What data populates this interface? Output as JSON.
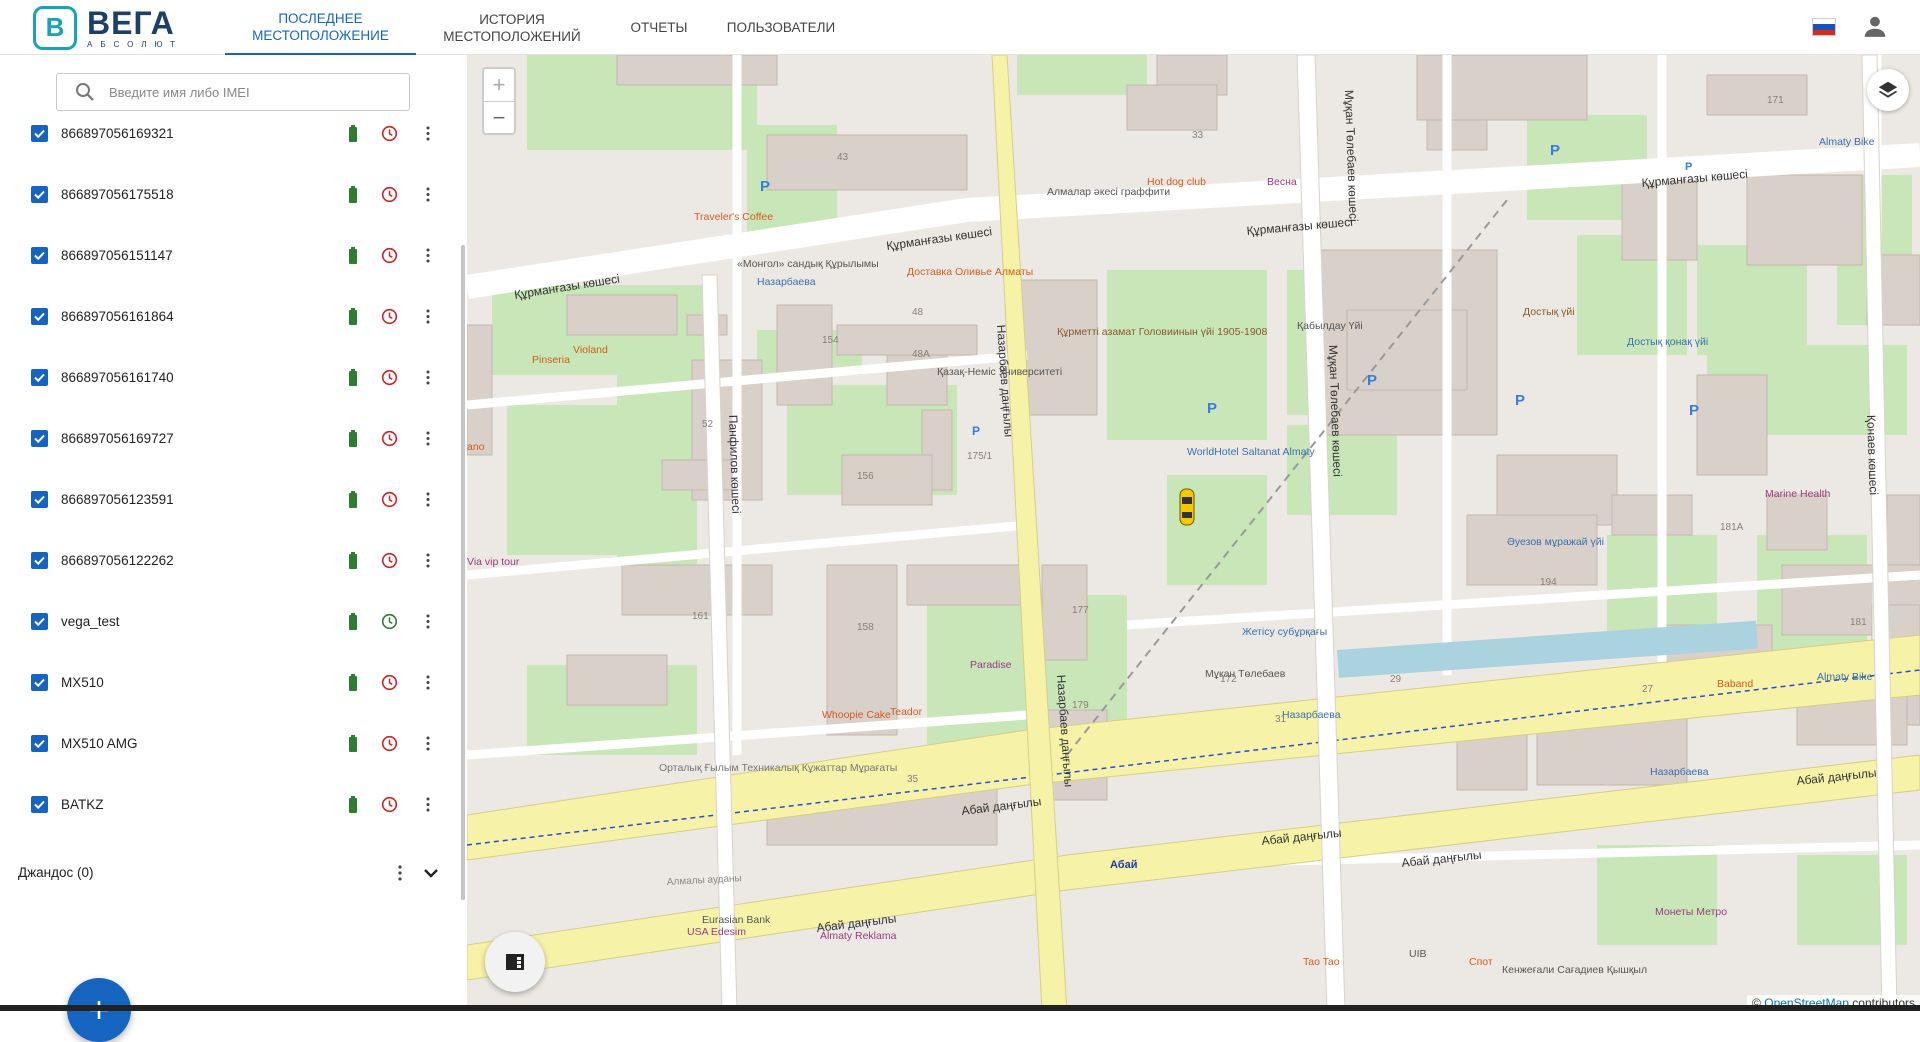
{
  "brand": {
    "name": "ВЕГА",
    "sub": "АБСОЛЮТ",
    "accent": "#1565c0",
    "logo_color": "#1aa3b6"
  },
  "nav": {
    "tabs": [
      {
        "line1": "ПОСЛЕДНЕЕ",
        "line2": "МЕСТОПОЛОЖЕНИЕ",
        "active": true
      },
      {
        "line1": "ИСТОРИЯ",
        "line2": "МЕСТОПОЛОЖЕНИЙ",
        "active": false
      },
      {
        "line1": "ОТЧЕТЫ",
        "line2": "",
        "active": false
      },
      {
        "line1": "ПОЛЬЗОВАТЕЛИ",
        "line2": "",
        "active": false
      }
    ],
    "language_flag": "ru-flag-icon",
    "user_icon": "account-icon"
  },
  "sidebar": {
    "search_placeholder": "Введите имя либо IMEI",
    "devices": [
      {
        "name": "866897056169321",
        "status": "inactive"
      },
      {
        "name": "866897056175518",
        "status": "inactive"
      },
      {
        "name": "866897056151147",
        "status": "inactive"
      },
      {
        "name": "866897056161864",
        "status": "inactive"
      },
      {
        "name": "866897056161740",
        "status": "inactive"
      },
      {
        "name": "866897056169727",
        "status": "inactive"
      },
      {
        "name": "866897056123591",
        "status": "inactive"
      },
      {
        "name": "866897056122262",
        "status": "inactive"
      },
      {
        "name": "vega_test",
        "status": "active"
      },
      {
        "name": "MX510",
        "status": "inactive"
      },
      {
        "name": "MX510 AMG",
        "status": "inactive"
      },
      {
        "name": "BATKZ",
        "status": "inactive"
      }
    ],
    "group": {
      "label": "Джандос (0)"
    },
    "colors": {
      "battery": "#2e7d32",
      "clock_inactive": "#c62828",
      "clock_active": "#2e7d32"
    }
  },
  "map": {
    "zoom_in": "+",
    "zoom_out": "−",
    "attribution_prefix": "©",
    "attribution_link": "OpenStreetMap",
    "attribution_suffix": "contributors",
    "labels": {
      "kurmangazy_1": "Құрманғазы көшесі",
      "kurmangazy_2": "Құрманғазы көшесі",
      "kurmangazy_3": "Құрманғазы көшесі",
      "kurmangazy_4": "Құрманғазы көшесі",
      "abai_1": "Абай даңғылы",
      "abai_2": "Абай даңғылы",
      "abai_3": "Абай даңғылы",
      "abai_4": "Абай даңғылы",
      "abai_5": "Абай даңғылы",
      "abai_station": "Абай",
      "nazarbaev_1": "Назарбаев даңғылы",
      "nazarbaev_2": "Назарбаев даңғылы",
      "panfilov": "Панфилов көшесі",
      "tolebaev_1": "Мұқан Төлебаев көшесі",
      "tolebaev_2": "Мұқан Төлебаев көшесі",
      "konaev": "Қонаев көшесі",
      "kaz_nem": "Қазақ-Неміс Университеті",
      "kabyldau": "Қабылдау Үйі",
      "worldhotel": "WorldHotel Saltanat Almaty",
      "auezov": "Әуезов мұражай үйі",
      "dostyk": "Достық үйі",
      "dostyk_kunak": "Достық қонақ үйі",
      "marine_health": "Marine Health",
      "violand": "Violand",
      "pinseria": "Pinseria",
      "traveler": "Traveler's Coffee",
      "mongol": "«Монгол» сандық Құрылымы",
      "dostavka": "Доставка Оливье Алматы",
      "hotdog": "Hot dog club",
      "vesna": "Весна",
      "almalar": "Алмалар әкесі граффити",
      "kurmet": "Құрметті азамат Головиинын үйі 1905-1908",
      "ortalyk": "Орталық Ғылым Техникалық Кұжаттар Мұрағаты",
      "whoopie": "Whoopie Cake",
      "teador": "Teador",
      "paradise": "Paradise",
      "zhetisu": "Жетісу субұрқағы",
      "mukan": "Мұқан Төлебаев",
      "nazarbaeva_bus_1": "Назарбаева",
      "nazarbaeva_bus_2": "Назарбаева",
      "nazarbaeva_bus_3": "Назарбаева",
      "almaty_bike_1": "Almaty Bike",
      "almaty_bike_2": "Almaty Bike",
      "baband": "Baband",
      "eurasian": "Eurasian Bank",
      "almaty_reklama": "Almaty Reklama",
      "usa_edesim": "USA Edesim",
      "tao_tao": "Tao Tao",
      "uib": "UIB",
      "spot": "Спот",
      "kenzhegali": "Кенжеғали Сағадиев Қышқыл",
      "monety": "Монеты Метро",
      "via_tour": "Via vip tour",
      "almaly": "Алмалы ауданы",
      "ano": "ano",
      "b43": "43",
      "b33": "33",
      "b171": "171",
      "b154": "154",
      "b48": "48",
      "b48a": "48А",
      "b52": "52",
      "b156": "156",
      "b175": "175/1",
      "b161": "161",
      "b158": "158",
      "b177": "177",
      "b179": "179",
      "b35": "35",
      "b172": "172",
      "b29": "29",
      "b31": "31",
      "b194": "194",
      "b27": "27",
      "b181a": "181А",
      "b181": "181"
    }
  }
}
